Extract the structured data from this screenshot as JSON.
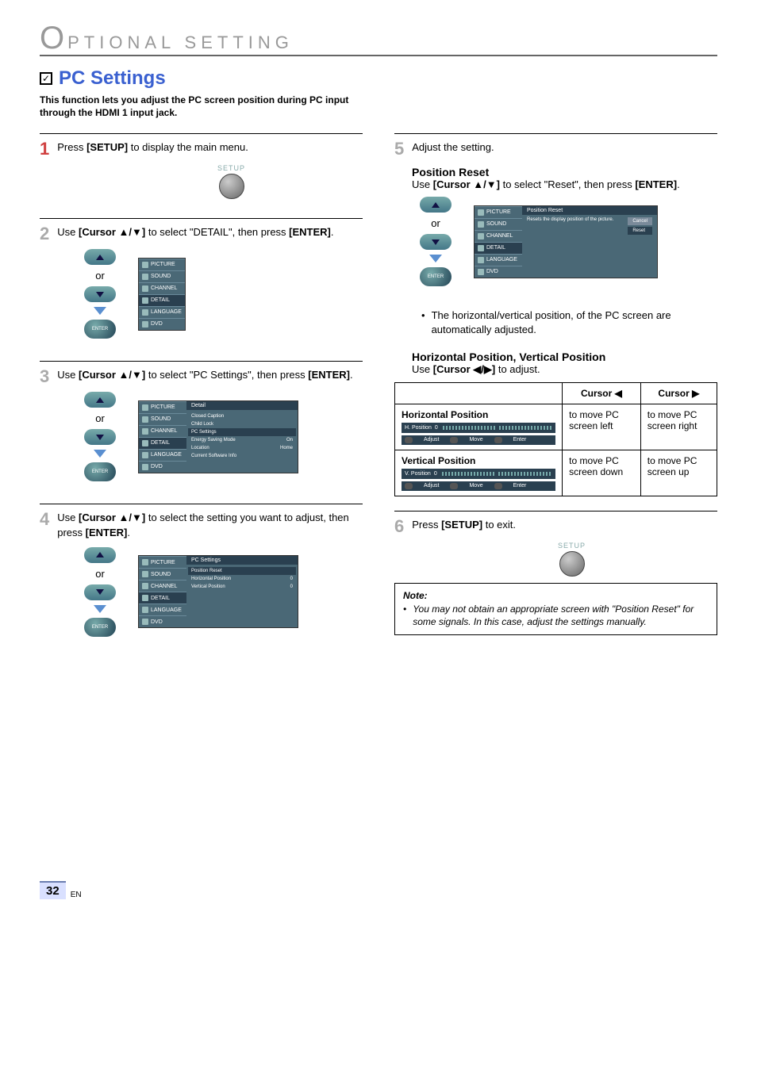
{
  "header": {
    "dropcap": "O",
    "rest": "PTIONAL  SETTING"
  },
  "title": {
    "check": "✓",
    "text": "PC Settings"
  },
  "subtitle": "This function lets you adjust the PC screen position during PC input through the HDMI 1 input jack.",
  "steps": {
    "1": {
      "pre": "Press ",
      "key": "[SETUP]",
      "post": " to display the main menu."
    },
    "2": {
      "pre": "Use ",
      "key": "[Cursor ▲/▼]",
      "mid": " to select \"DETAIL\", then press ",
      "key2": "[ENTER]",
      "post": "."
    },
    "3": {
      "pre": "Use ",
      "key": "[Cursor ▲/▼]",
      "mid": " to select \"PC Settings\", then press ",
      "key2": "[ENTER]",
      "post": "."
    },
    "4": {
      "pre": "Use ",
      "key": "[Cursor ▲/▼]",
      "mid": " to select the setting you want to adjust, then press ",
      "key2": "[ENTER]",
      "post": "."
    },
    "5": {
      "text": "Adjust the setting."
    },
    "6": {
      "pre": "Press ",
      "key": "[SETUP]",
      "post": " to exit."
    }
  },
  "setup_label": "SETUP",
  "or": "or",
  "enter": "ENTER",
  "menu": {
    "items": [
      "PICTURE",
      "SOUND",
      "CHANNEL",
      "DETAIL",
      "LANGUAGE",
      "DVD"
    ],
    "selected": "DETAIL"
  },
  "detail_panel": {
    "title": "Detail",
    "rows": [
      {
        "l": "Closed Caption",
        "r": ""
      },
      {
        "l": "Child Lock",
        "r": ""
      },
      {
        "l": "PC Settings",
        "r": "",
        "sel": true
      },
      {
        "l": "Energy Saving Mode",
        "r": "On"
      },
      {
        "l": "Location",
        "r": "Home"
      },
      {
        "l": "Current Software Info",
        "r": ""
      }
    ]
  },
  "pcsettings_panel": {
    "title": "PC Settings",
    "rows": [
      {
        "l": "Position Reset",
        "r": "",
        "sel": true
      },
      {
        "l": "Horizontal Position",
        "r": "0"
      },
      {
        "l": "Vertical Position",
        "r": "0"
      }
    ]
  },
  "position_reset": {
    "heading": "Position Reset",
    "pre": "Use ",
    "key": "[Cursor ▲/▼]",
    "mid": " to select \"Reset\", then press ",
    "key2": "[ENTER]",
    "post": ".",
    "panel_title": "Position Reset",
    "msg": "Resets the display position of the picture.",
    "btn1": "Cancel",
    "btn2": "Reset",
    "bullet": "The horizontal/vertical position, of the PC screen are automatically adjusted."
  },
  "hvpos": {
    "heading": "Horizontal Position, Vertical Position",
    "pre": "Use ",
    "key": "[Cursor ◀/▶]",
    "post": " to adjust.",
    "th_left": "Cursor ◀",
    "th_right": "Cursor ▶",
    "hpos_title": "Horizontal Position",
    "hpos_label": "H. Position",
    "hpos_val": "0",
    "hpos_left": "to move PC screen left",
    "hpos_right": "to move PC screen right",
    "vpos_title": "Vertical Position",
    "vpos_label": "V. Position",
    "vpos_val": "0",
    "vpos_left": "to move PC screen down",
    "vpos_right": "to move PC screen up",
    "help_adjust": "Adjust",
    "help_move": "Move",
    "help_enter": "Enter"
  },
  "note": {
    "title": "Note:",
    "text": "You may not obtain an appropriate screen with \"Position Reset\" for some signals. In this case, adjust the settings manually."
  },
  "footer": {
    "page": "32",
    "lang": "EN"
  }
}
